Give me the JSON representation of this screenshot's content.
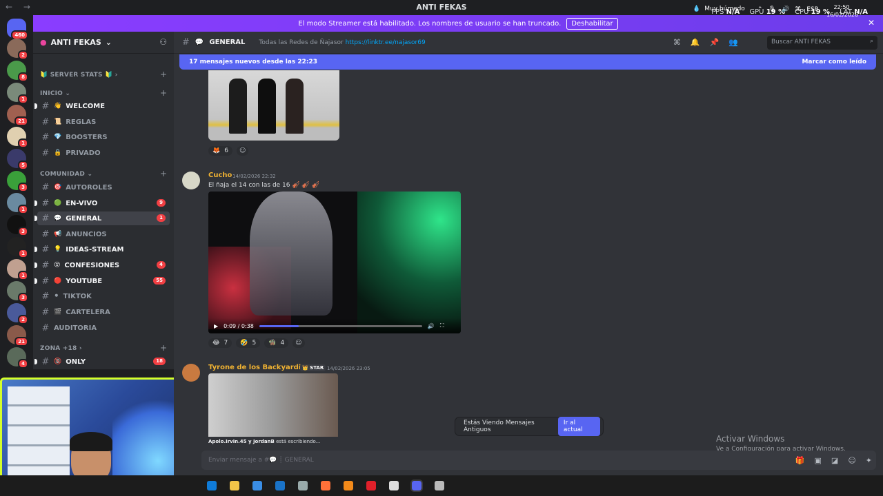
{
  "titlebar": {
    "title": "ANTI FEKAS",
    "fps_label": "FPS",
    "fps_value": "N/A",
    "gpu_label": "GPU",
    "gpu_value": "19 %",
    "cpu_label": "CPU",
    "cpu_value": "19 %",
    "lat_label": "LAT",
    "lat_value": "N/A"
  },
  "banner": {
    "text": "El modo Streamer está habilitado. Los nombres de usuario se han truncado.",
    "button": "Deshabilitar"
  },
  "rail": {
    "home_badge": "460",
    "servers": [
      {
        "badge": "2",
        "color": "#8a6a5a"
      },
      {
        "badge": "8",
        "color": "#4a9a4a"
      },
      {
        "badge": "1",
        "color": "#7a8a7a"
      },
      {
        "badge": "21",
        "color": "#a06050"
      },
      {
        "badge": "1",
        "color": "#e0d0b0"
      },
      {
        "badge": "5",
        "color": "#3a3a6a"
      },
      {
        "badge": "3",
        "color": "#3aa03a"
      },
      {
        "badge": "1",
        "color": "#6a8aa0"
      },
      {
        "badge": "3",
        "color": "#111111"
      },
      {
        "badge": "1",
        "color": "#222222"
      },
      {
        "badge": "1",
        "color": "#c0a090"
      },
      {
        "badge": "3",
        "color": "#6a7a6a"
      },
      {
        "badge": "2",
        "color": "#4a5a9a"
      },
      {
        "badge": "21",
        "color": "#8a5a4a"
      },
      {
        "badge": "4",
        "color": "#5a6a5a"
      }
    ]
  },
  "sidebar": {
    "server_name": "ANTI FEKAS",
    "cat_stats": "SERVER STATS",
    "cat_inicio": "INICIO",
    "cat_comunidad": "COMUNIDAD",
    "cat_zona": "ZONA +18",
    "channels": [
      {
        "name": "WELCOME",
        "emoji": "👋"
      },
      {
        "name": "REGLAS",
        "emoji": "📜"
      },
      {
        "name": "BOOSTERS",
        "emoji": "💎"
      },
      {
        "name": "PRIVADO",
        "emoji": "🔒"
      },
      {
        "name": "AUTOROLES",
        "emoji": "🎯"
      },
      {
        "name": "EN-VIVO",
        "emoji": "🟢",
        "count": "9"
      },
      {
        "name": "GENERAL",
        "emoji": "💬",
        "count": "1"
      },
      {
        "name": "ANUNCIOS",
        "emoji": "📢"
      },
      {
        "name": "IDEAS-STREAM",
        "emoji": "💡"
      },
      {
        "name": "CONFESIONES",
        "emoji": "😮",
        "count": "4"
      },
      {
        "name": "YOUTUBE",
        "emoji": "🔴",
        "count": "55"
      },
      {
        "name": "TIKTOK",
        "emoji": "⚫"
      },
      {
        "name": "CARTELERA",
        "emoji": "🎬"
      },
      {
        "name": "AUDITORIA",
        "emoji": ""
      },
      {
        "name": "ONLY",
        "emoji": "🔞",
        "count": "18"
      }
    ]
  },
  "header": {
    "channel": "GENERAL",
    "topic_text": "Todas las Redes de Ñajasor",
    "topic_link": "https://linktr.ee/najasor69",
    "search_placeholder": "Buscar ANTI FEKAS"
  },
  "newbar": {
    "text": "17 mensajes nuevos desde las 22:23",
    "action": "Marcar como leído"
  },
  "messages": {
    "m0_reacts": [
      {
        "emoji": "🦊",
        "count": "6"
      }
    ],
    "m1": {
      "user": "Cucho",
      "ts": "14/02/2026 22:32",
      "text": "El ñaja el 14 con las de 16 🎻 🎻 🎻"
    },
    "m1_video": {
      "time": "0:09 / 0:38",
      "progress": 0.24
    },
    "m1_reacts": [
      {
        "emoji": "😂",
        "count": "7"
      },
      {
        "emoji": "🤣",
        "count": "5"
      },
      {
        "emoji": "🧌",
        "count": "4"
      }
    ],
    "m2": {
      "user": "Tyrone de los Backyardigans",
      "tag": "STAR",
      "ts": "14/02/2026 23:05"
    }
  },
  "typing": {
    "users": "Apolo.Irvin.45 y JordanB",
    "suffix": "está escribiendo..."
  },
  "jump": {
    "text": "Estás Viendo Mensajes Antiguos",
    "button": "Ir al actual"
  },
  "composer": {
    "placeholder": "Enviar mensaje a #💬 ┊ GENERAL"
  },
  "activate": {
    "title": "Activar Windows",
    "subtitle": "Ve a Configuración para activar Windows."
  },
  "taskbar": {
    "weather": "Muy húmedo",
    "lang": "ESP",
    "time": "22:50",
    "date": "16/02/2026"
  }
}
